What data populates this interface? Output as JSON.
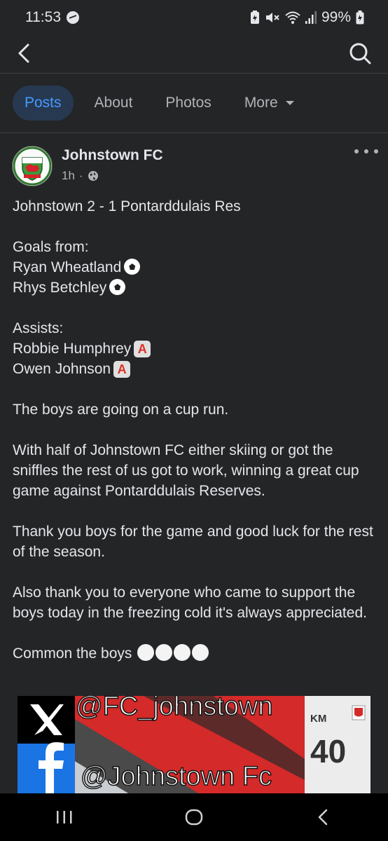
{
  "status_bar": {
    "time": "11:53",
    "battery": "99%",
    "icons": [
      "messenger-icon",
      "battery-saver-icon",
      "mute-icon",
      "wifi-icon",
      "signal-icon",
      "battery-icon"
    ]
  },
  "topbar": {
    "back_icon": "back-arrow-icon",
    "search_icon": "search-icon"
  },
  "tabs": [
    {
      "label": "Posts",
      "active": true
    },
    {
      "label": "About",
      "active": false
    },
    {
      "label": "Photos",
      "active": false
    },
    {
      "label": "More",
      "active": false
    }
  ],
  "post": {
    "author": "Johnstown FC",
    "time": "1h",
    "audience_icon": "globe-icon",
    "menu_icon": "more-options-icon",
    "score_line": "Johnstown 2 - 1 Pontarddulais Res",
    "goals_heading": "Goals from:",
    "scorers": [
      "Ryan Wheatland",
      "Rhys Betchley"
    ],
    "assists_heading": "Assists:",
    "assisters": [
      "Robbie Humphrey",
      "Owen Johnson"
    ],
    "assist_badge": "A",
    "paragraph_1": "The boys are going on a cup run.",
    "paragraph_2": "With half of Johnstown FC either skiing or got the sniffles the rest of us got to work, winning a great cup game against Pontarddulais Reserves.",
    "paragraph_3": "Thank you boys for the game and good luck for the rest of the season.",
    "paragraph_4": "Also thank you to everyone who came to support the boys today in the freezing cold it's always appreciated.",
    "closing": "Common the boys"
  },
  "post_image": {
    "x_handle": "@FC_johnstown",
    "facebook_handle": "@Johnstown Fc",
    "shirt_initials": "KM",
    "shirt_number": "40"
  },
  "nav_bar": {
    "icons": [
      "recent-apps-icon",
      "home-icon",
      "back-icon"
    ]
  },
  "colors": {
    "background": "#242526",
    "accent": "#4599ff",
    "active_tab_bg": "#263951",
    "text": "#e4e6eb",
    "muted": "#b0b3b8"
  }
}
